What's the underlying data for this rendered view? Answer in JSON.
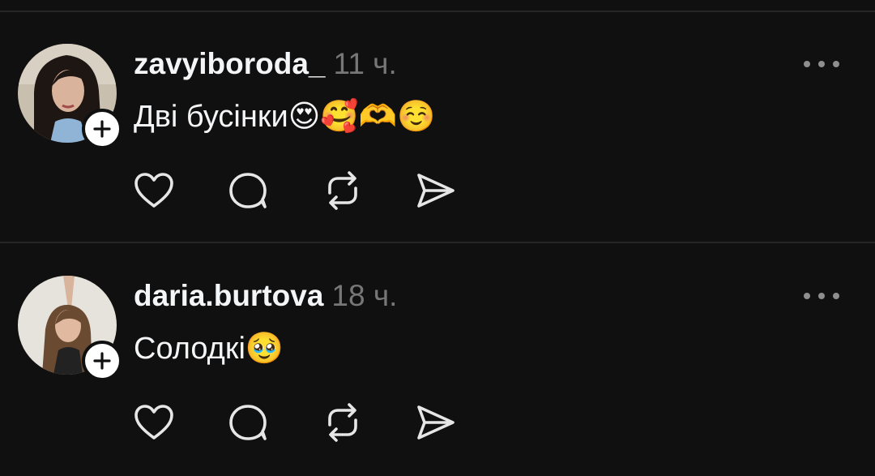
{
  "posts": [
    {
      "username": "zavyiboroda_",
      "time": "11 ч.",
      "text": "Дві бусінки😍🥰🫶☺️",
      "avatar_icon": "avatar-photo",
      "follow_icon": "plus-icon"
    },
    {
      "username": "daria.burtova",
      "time": "18 ч.",
      "text": "Солодкі🥹",
      "avatar_icon": "avatar-photo",
      "follow_icon": "plus-icon"
    }
  ],
  "actions": [
    "heart-icon",
    "comment-icon",
    "repost-icon",
    "share-icon"
  ],
  "colors": {
    "background": "#101010",
    "text": "#f3f5f7",
    "muted": "#777777",
    "divider": "#262626",
    "icon": "#e6e6e6"
  }
}
